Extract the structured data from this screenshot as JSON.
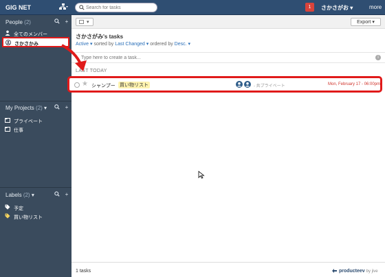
{
  "topbar": {
    "brand": "GIG NET",
    "search_placeholder": "Search for tasks",
    "notification_count": "1",
    "user_name": "さかさがお",
    "more_label": "more"
  },
  "sidebar": {
    "people": {
      "title": "People",
      "count": "(2)",
      "items": [
        {
          "label": "全てのメンバー",
          "icon": "people-icon"
        },
        {
          "label": "さかさかみ",
          "icon": "user-icon",
          "selected": true
        }
      ]
    },
    "projects": {
      "title": "My Projects",
      "count": "(2)",
      "items": [
        {
          "label": "プライベート",
          "icon": "folder-icon"
        },
        {
          "label": "仕事",
          "icon": "folder-icon"
        }
      ]
    },
    "labels": {
      "title": "Labels",
      "count": "(2)",
      "items": [
        {
          "label": "予定",
          "icon": "tag-icon",
          "color": "#ffffff"
        },
        {
          "label": "買い物リスト",
          "icon": "tag-icon",
          "color": "#f4d35e"
        }
      ]
    }
  },
  "main": {
    "export_label": "Export",
    "view_title": "さかさがみ's tasks",
    "sort": {
      "filter": "Active",
      "sorted_by_text": "sorted by",
      "sort_field": "Last Changed",
      "ordered_by_text": "ordered by",
      "order": "Desc."
    },
    "create_placeholder": "Type here to create a task...",
    "group_label": "LAST TODAY",
    "task": {
      "name": "シャンプー",
      "tag": "買い物リスト",
      "project": "- 共プライベート",
      "due": "Mon, February 17 - 06:00pm"
    },
    "footer": {
      "count": "1 tasks",
      "logo": "producteev",
      "logo_by": "by jive"
    }
  },
  "colors": {
    "topbar": "#2f4e72",
    "sidebar": "#3a4b5d",
    "highlight": "#e01a1a",
    "link": "#2a6fb8",
    "due": "#d0342c"
  }
}
